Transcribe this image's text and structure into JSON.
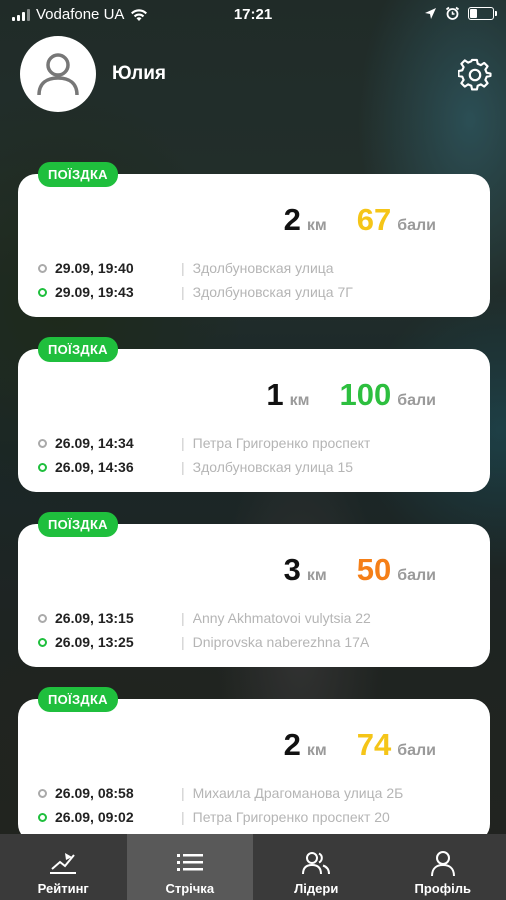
{
  "status_bar": {
    "carrier": "Vodafone UA",
    "time": "17:21",
    "battery_level": 0.35
  },
  "header": {
    "user_name": "Юлия"
  },
  "trips": [
    {
      "tag": "ПОЇЗДКА",
      "distance": "2",
      "distance_unit": "км",
      "points": "67",
      "points_unit": "бали",
      "points_color": "#f5c518",
      "start_time": "29.09, 19:40",
      "start_address": "Здолбуновская улица",
      "end_time": "29.09, 19:43",
      "end_address": "Здолбуновская улица 7Г"
    },
    {
      "tag": "ПОЇЗДКА",
      "distance": "1",
      "distance_unit": "км",
      "points": "100",
      "points_unit": "бали",
      "points_color": "#2dbf3f",
      "start_time": "26.09, 14:34",
      "start_address": "Петра Григоренко проспект",
      "end_time": "26.09, 14:36",
      "end_address": "Здолбуновская улица 15"
    },
    {
      "tag": "ПОЇЗДКА",
      "distance": "3",
      "distance_unit": "км",
      "points": "50",
      "points_unit": "бали",
      "points_color": "#f57f17",
      "start_time": "26.09, 13:15",
      "start_address": "Anny Akhmatovoi vulytsia 22",
      "end_time": "26.09, 13:25",
      "end_address": "Dniprovska naberezhna 17A"
    },
    {
      "tag": "ПОЇЗДКА",
      "distance": "2",
      "distance_unit": "км",
      "points": "74",
      "points_unit": "бали",
      "points_color": "#f5c518",
      "start_time": "26.09, 08:58",
      "start_address": "Михаила Драгоманова улица 2Б",
      "end_time": "26.09, 09:02",
      "end_address": "Петра Григоренко проспект 20"
    }
  ],
  "tabbar": {
    "items": [
      {
        "label": "Рейтинг",
        "icon": "rating-chart-icon",
        "active": false
      },
      {
        "label": "Стрічка",
        "icon": "list-icon",
        "active": true
      },
      {
        "label": "Лідери",
        "icon": "users-icon",
        "active": false
      },
      {
        "label": "Профіль",
        "icon": "profile-icon",
        "active": false
      }
    ]
  },
  "colors": {
    "accent_green": "#1fbf3d",
    "tabbar_bg": "#3a3a3a",
    "tabbar_active_bg": "#595959"
  }
}
